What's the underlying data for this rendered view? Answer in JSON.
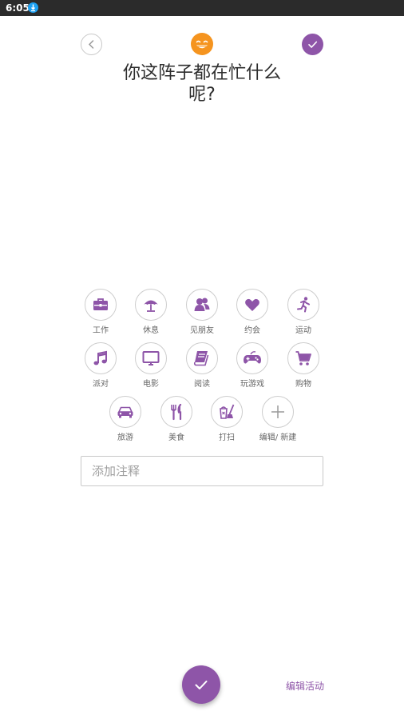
{
  "status_bar": {
    "time": "6:05"
  },
  "header": {
    "title": "你这阵子都在忙什么呢?"
  },
  "colors": {
    "accent": "#8e55a8",
    "mood": "#f5941f",
    "status_bar": "#2b2b2b"
  },
  "activities": [
    {
      "label": "工作",
      "icon": "briefcase-icon"
    },
    {
      "label": "休息",
      "icon": "umbrella-icon"
    },
    {
      "label": "见朋友",
      "icon": "people-icon"
    },
    {
      "label": "约会",
      "icon": "heart-icon"
    },
    {
      "label": "运动",
      "icon": "running-icon"
    },
    {
      "label": "派对",
      "icon": "music-icon"
    },
    {
      "label": "电影",
      "icon": "monitor-icon"
    },
    {
      "label": "阅读",
      "icon": "book-icon"
    },
    {
      "label": "玩游戏",
      "icon": "gamepad-icon"
    },
    {
      "label": "购物",
      "icon": "cart-icon"
    },
    {
      "label": "旅游",
      "icon": "car-icon"
    },
    {
      "label": "美食",
      "icon": "cutlery-icon"
    },
    {
      "label": "打扫",
      "icon": "cleaning-icon"
    },
    {
      "label": "编辑/ 新建",
      "icon": "plus-icon"
    }
  ],
  "note": {
    "placeholder": "添加注释",
    "value": ""
  },
  "footer": {
    "edit_label": "编辑活动"
  }
}
